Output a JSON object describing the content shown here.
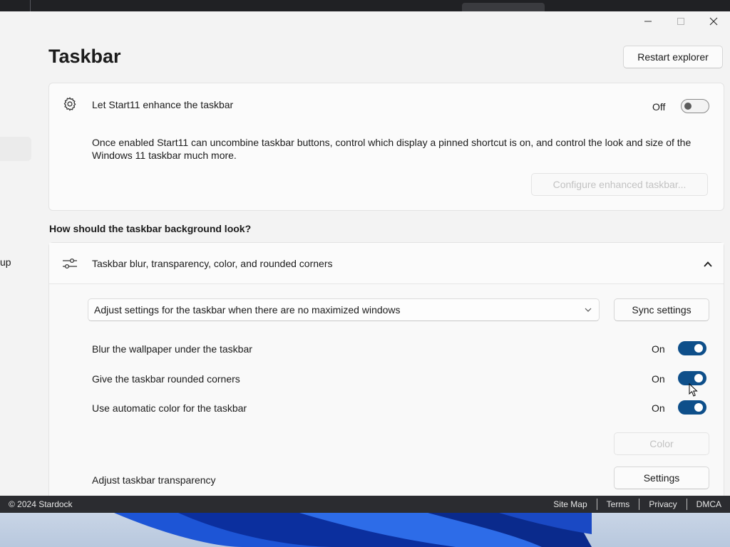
{
  "window": {
    "controls": {
      "minimize": "—",
      "maximize": "☐",
      "close": "✕"
    }
  },
  "sidebar": {
    "partial_label": "up"
  },
  "page": {
    "title": "Taskbar",
    "restart_button": "Restart explorer"
  },
  "enhance_card": {
    "icon": "gear-icon",
    "label": "Let Start11 enhance the taskbar",
    "state": "Off",
    "description": "Once enabled Start11 can uncombine taskbar buttons, control which display a pinned shortcut is on, and control the look and size of the Windows 11 taskbar much more.",
    "configure_button": "Configure enhanced taskbar..."
  },
  "background_section": {
    "question": "How should the taskbar background look?",
    "header_icon": "sliders-icon",
    "header_label": "Taskbar blur, transparency, color, and rounded corners",
    "collapse_icon": "chevron-up-icon",
    "select_value": "Adjust settings for the taskbar when there are no maximized windows",
    "sync_button": "Sync settings",
    "rows": [
      {
        "label": "Blur the wallpaper under the taskbar",
        "state": "On"
      },
      {
        "label": "Give the taskbar rounded corners",
        "state": "On"
      },
      {
        "label": "Use automatic color for the taskbar",
        "state": "On"
      }
    ],
    "color_button": "Color",
    "transparency_label": "Adjust taskbar transparency",
    "settings_button": "Settings"
  },
  "footer": {
    "copyright": "© 2024 Stardock",
    "links": [
      "Site Map",
      "Terms",
      "Privacy",
      "DMCA"
    ]
  },
  "colors": {
    "accent": "#0e4f8a",
    "footer_bg": "#2b2c30",
    "window_bg": "#f3f3f3"
  }
}
